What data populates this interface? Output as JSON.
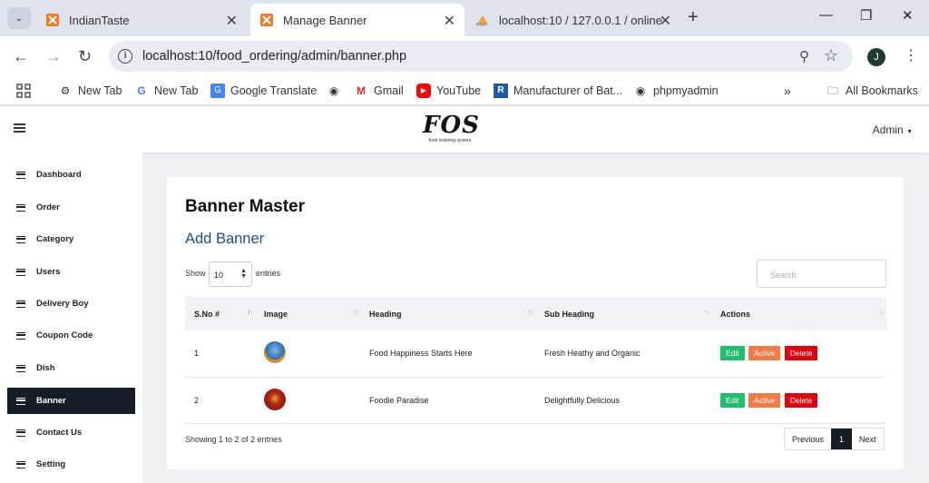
{
  "browser": {
    "tabs": [
      {
        "title": "IndianTaste",
        "icon": "xampp-icon"
      },
      {
        "title": "Manage Banner",
        "icon": "xampp-icon"
      },
      {
        "title": "localhost:10 / 127.0.0.1 / online...",
        "icon": "phpmyadmin-icon"
      }
    ],
    "url": "localhost:10/food_ordering/admin/banner.php",
    "profile_initial": "J",
    "bookmarks": [
      {
        "label": "New Tab",
        "icon": "gear-icon"
      },
      {
        "label": "New Tab",
        "icon": "google-icon"
      },
      {
        "label": "Google Translate",
        "icon": "translate-icon"
      },
      {
        "label": "",
        "icon": "globe-icon"
      },
      {
        "label": "Gmail",
        "icon": "gmail-icon"
      },
      {
        "label": "YouTube",
        "icon": "youtube-icon"
      },
      {
        "label": "Manufacturer of Bat...",
        "icon": "r-icon"
      },
      {
        "label": "phpmyadmin",
        "icon": "globe-icon"
      }
    ],
    "all_bookmarks": "All Bookmarks"
  },
  "header": {
    "logo_text": "FOS",
    "logo_tagline": "food ordering system",
    "admin_label": "Admin"
  },
  "sidebar": {
    "items": [
      {
        "label": "Dashboard"
      },
      {
        "label": "Order"
      },
      {
        "label": "Category"
      },
      {
        "label": "Users"
      },
      {
        "label": "Delivery Boy"
      },
      {
        "label": "Coupon Code"
      },
      {
        "label": "Dish"
      },
      {
        "label": "Banner",
        "active": true
      },
      {
        "label": "Contact Us"
      },
      {
        "label": "Setting"
      }
    ]
  },
  "main": {
    "title": "Banner Master",
    "add_link": "Add Banner",
    "show_label": "Show",
    "show_value": "10",
    "entries_label": "entries",
    "search_placeholder": "Search",
    "columns": [
      "S.No #",
      "Image",
      "Heading",
      "Sub Heading",
      "Actions"
    ],
    "rows": [
      {
        "sno": "1",
        "heading": "Food Happiness Starts Here",
        "sub_heading": "Fresh Heathy and Organic",
        "image_color": "#2c6fb0"
      },
      {
        "sno": "2",
        "heading": "Foodie Paradise",
        "sub_heading": "Delightfully Delicious",
        "image_color": "#8b1010"
      }
    ],
    "actions": {
      "edit": "Edit",
      "active": "Active",
      "delete": "Delete"
    },
    "info": "Showing 1 to 2 of 2 entries",
    "pager": {
      "previous": "Previous",
      "current": "1",
      "next": "Next"
    }
  },
  "colors": {
    "edit": "#1fbf6f",
    "active": "#ef7b45",
    "delete": "#e3000d",
    "sidebar_active": "#171d26",
    "link": "#1d4f8b"
  }
}
